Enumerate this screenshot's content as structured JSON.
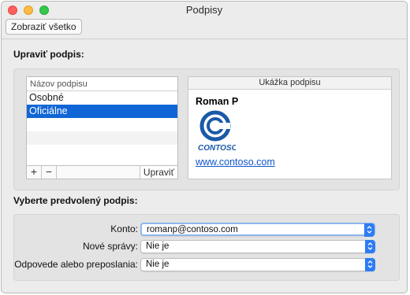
{
  "window": {
    "title": "Podpisy"
  },
  "toolbar": {
    "show_all_label": "Zobraziť všetko"
  },
  "edit_section": {
    "title": "Upraviť podpis:",
    "list": {
      "header": "Názov podpisu",
      "items": [
        {
          "label": "Osobné",
          "selected": false
        },
        {
          "label": "Oficiálne",
          "selected": true
        }
      ]
    },
    "buttons": {
      "add": "+",
      "remove": "−",
      "edit": "Upraviť"
    },
    "preview": {
      "header": "Ukážka podpisu",
      "name": "Roman P",
      "logo_text": "CONTOSO",
      "link": "www.contoso.com"
    }
  },
  "default_section": {
    "title": "Vyberte predvolený podpis:",
    "rows": [
      {
        "label": "Konto:",
        "value": "romanp@contoso.com"
      },
      {
        "label": "Nové správy:",
        "value": "Nie je"
      },
      {
        "label": "Odpovede alebo preposlania:",
        "value": "Nie je"
      }
    ]
  },
  "colors": {
    "selection": "#1166d6",
    "link": "#1155cc",
    "popup_accent": "#2d7cf4",
    "logo_blue": "#1a5aa8"
  }
}
